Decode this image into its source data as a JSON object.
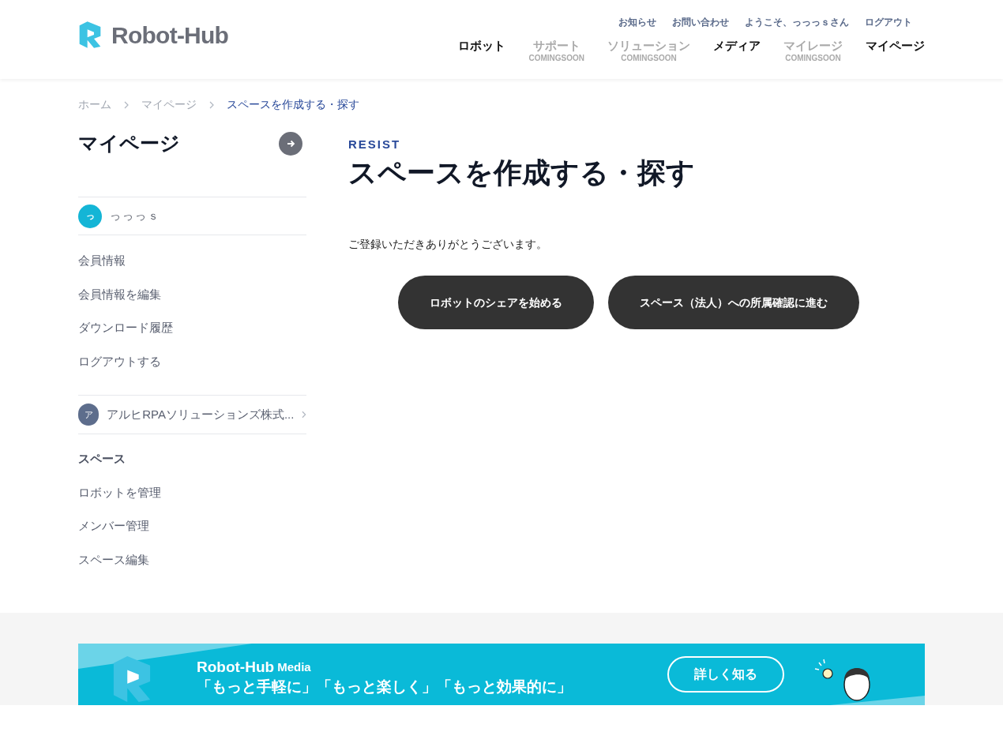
{
  "header": {
    "logo_text": "Robot-Hub",
    "top_links": [
      "お知らせ",
      "お問い合わせ",
      "ようこそ、っっっｓさん",
      "ログアウト"
    ],
    "nav": [
      {
        "label": "ロボット",
        "disabled": false
      },
      {
        "label": "サポート",
        "disabled": true,
        "note": "COMINGSOON"
      },
      {
        "label": "ソリューション",
        "disabled": true,
        "note": "COMINGSOON"
      },
      {
        "label": "メディア",
        "disabled": false
      },
      {
        "label": "マイレージ",
        "disabled": true,
        "note": "COMINGSOON"
      },
      {
        "label": "マイページ",
        "disabled": false
      }
    ]
  },
  "breadcrumb": [
    {
      "label": "ホーム",
      "selected": false
    },
    {
      "label": "マイページ",
      "selected": false
    },
    {
      "label": "スペースを作成する・探す",
      "selected": true
    }
  ],
  "sidebar": {
    "title": "マイページ",
    "user": {
      "initial": "っ",
      "name": "っっっｓ"
    },
    "user_links": [
      "会員情報",
      "会員情報を編集",
      "ダウンロード履歴",
      "ログアウトする"
    ],
    "space": {
      "initial": "ア",
      "name": "アルヒRPAソリューションズ株式..."
    },
    "space_heading": "スペース",
    "space_links": [
      "ロボットを管理",
      "メンバー管理",
      "スペース編集"
    ]
  },
  "main": {
    "eyebrow": "RESIST",
    "title": "スペースを作成する・探す",
    "message": "ご登録いただきありがとうございます。",
    "buttons": [
      "ロボットのシェアを始める",
      "スペース（法人）への所属確認に進む"
    ]
  },
  "banner": {
    "brand": "Robot-Hub",
    "brand_suffix": "Media",
    "tagline": "「もっと手軽に」「もっと楽しく」「もっと効果的に」",
    "button": "詳しく知る"
  }
}
